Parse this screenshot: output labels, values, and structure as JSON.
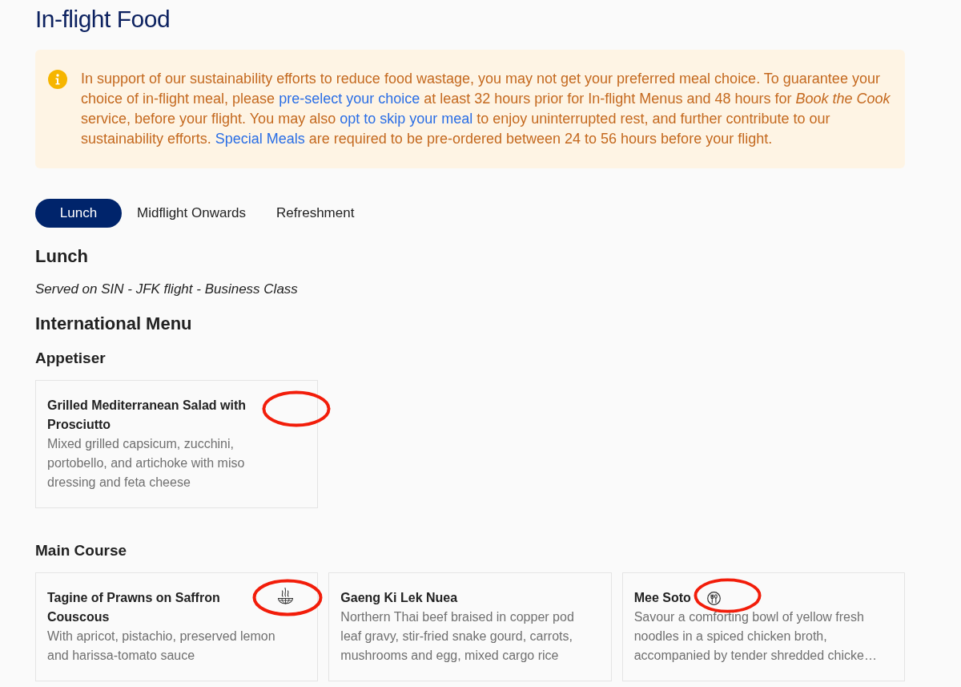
{
  "page": {
    "title": "In-flight Food"
  },
  "notice": {
    "segments": [
      {
        "kind": "text",
        "text": "In support of our sustainability efforts to reduce food wastage, you may not get your preferred meal choice. To guarantee your choice of in-flight meal, please "
      },
      {
        "kind": "link",
        "text": "pre-select your choice"
      },
      {
        "kind": "text",
        "text": " at least 32 hours prior for In-flight Menus and 48 hours for *Book the Cook* service, before your flight. You may also "
      },
      {
        "kind": "link",
        "text": "opt to skip your meal"
      },
      {
        "kind": "text",
        "text": " to enjoy uninterrupted rest, and further contribute to our sustainability efforts. "
      },
      {
        "kind": "link",
        "text": "Special Meals"
      },
      {
        "kind": "text",
        "text": " are required to be pre-ordered between 24 to 56 hours before your flight."
      }
    ]
  },
  "tabs": [
    {
      "label": "Lunch",
      "selected": true
    },
    {
      "label": "Midflight Onwards",
      "selected": false
    },
    {
      "label": "Refreshment",
      "selected": false
    }
  ],
  "menu": {
    "heading": "Lunch",
    "subtitle": "Served on SIN - JFK flight - Business Class",
    "title": "International Menu",
    "sections": [
      {
        "heading": "Appetiser",
        "dishes": [
          {
            "name": "Grilled Mediterranean Salad with Prosciutto",
            "description": "Mixed grilled capsicum, zucchini, portobello, and artichoke with miso dressing and feta cheese",
            "kind": "plain",
            "circled": true
          }
        ]
      },
      {
        "heading": "Main Course",
        "dishes": [
          {
            "name": "Tagine of Prawns on Saffron Couscous",
            "description": "With apricot, pistachio, preserved lemon and harissa-tomato sauce",
            "kind": "steam",
            "circled": true
          },
          {
            "name": "Gaeng Ki Lek Nuea",
            "description": "Northern Thai beef braised in copper pod leaf gravy, stir-fried snake gourd, carrots, mushrooms and egg, mixed cargo rice",
            "kind": "plain",
            "circled": false
          },
          {
            "name": "Mee Soto",
            "description": "Savour a comforting bowl of yellow fresh noodles in a spiced chicken broth, accompanied by tender shredded chicke…",
            "kind": "utensils",
            "circled": true
          }
        ]
      }
    ]
  }
}
